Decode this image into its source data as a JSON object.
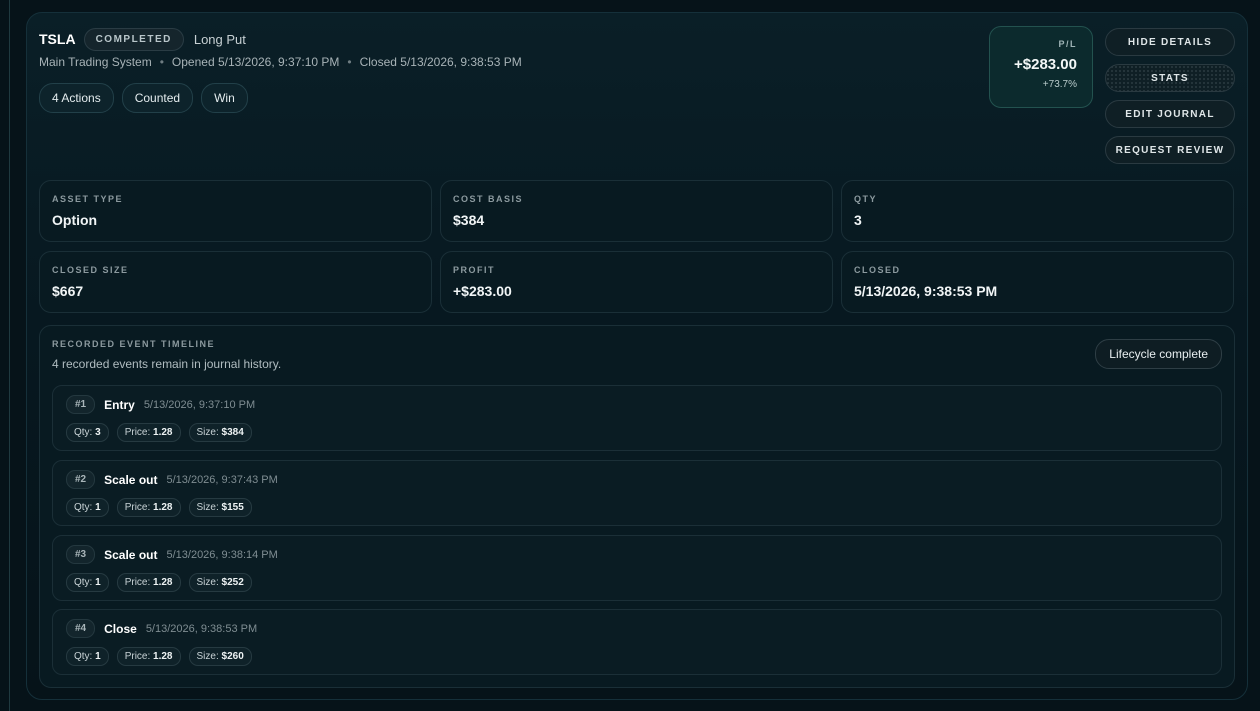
{
  "trade": {
    "ticker": "TSLA",
    "status": "COMPLETED",
    "strategy": "Long Put",
    "system": "Main Trading System",
    "opened": "Opened 5/13/2026, 9:37:10 PM",
    "closed": "Closed 5/13/2026, 9:38:53 PM",
    "chips": [
      "4 Actions",
      "Counted",
      "Win"
    ]
  },
  "pl": {
    "label": "P/L",
    "value": "+$283.00",
    "percent": "+73.7%"
  },
  "actions": {
    "hide_details": "HIDE DETAILS",
    "stats": "STATS",
    "edit_journal": "EDIT JOURNAL",
    "request_review": "REQUEST REVIEW"
  },
  "stats": [
    {
      "label": "ASSET TYPE",
      "value": "Option"
    },
    {
      "label": "COST BASIS",
      "value": "$384"
    },
    {
      "label": "QTY",
      "value": "3"
    },
    {
      "label": "CLOSED SIZE",
      "value": "$667"
    },
    {
      "label": "PROFIT",
      "value": "+$283.00"
    },
    {
      "label": "CLOSED",
      "value": "5/13/2026, 9:38:53 PM"
    }
  ],
  "timeline": {
    "label": "RECORDED EVENT TIMELINE",
    "subtitle": "4 recorded events remain in journal history.",
    "badge": "Lifecycle complete",
    "events": [
      {
        "num": "#1",
        "name": "Entry",
        "time": "5/13/2026, 9:37:10 PM",
        "qty": "3",
        "price": "1.28",
        "size": "$384"
      },
      {
        "num": "#2",
        "name": "Scale out",
        "time": "5/13/2026, 9:37:43 PM",
        "qty": "1",
        "price": "1.28",
        "size": "$155"
      },
      {
        "num": "#3",
        "name": "Scale out",
        "time": "5/13/2026, 9:38:14 PM",
        "qty": "1",
        "price": "1.28",
        "size": "$252"
      },
      {
        "num": "#4",
        "name": "Close",
        "time": "5/13/2026, 9:38:53 PM",
        "qty": "1",
        "price": "1.28",
        "size": "$260"
      }
    ]
  },
  "field_labels": {
    "qty": "Qty:",
    "price": "Price:",
    "size": "Size:"
  }
}
